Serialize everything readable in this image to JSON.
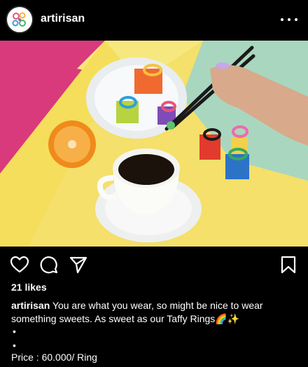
{
  "post": {
    "username": "artirisan",
    "likes_text": "21 likes",
    "caption_username": "artirisan",
    "caption_text": "You are what you wear, so might be nice to wear something sweets. As sweet as our Taffy Rings",
    "caption_emoji": "🌈✨",
    "dot1": "•",
    "dot2": "•",
    "price_text": "Price : 60.000/ Ring"
  },
  "icons": {
    "avatar": "brand-logo",
    "more": "more-horizontal-icon",
    "like": "heart-icon",
    "comment": "comment-icon",
    "share": "send-icon",
    "save": "bookmark-icon"
  },
  "colors": {
    "background": "#000000",
    "text": "#ffffff",
    "photo_pink": "#d93a7c",
    "photo_yellow": "#f4e06a",
    "photo_mint": "#a9d6bf"
  }
}
